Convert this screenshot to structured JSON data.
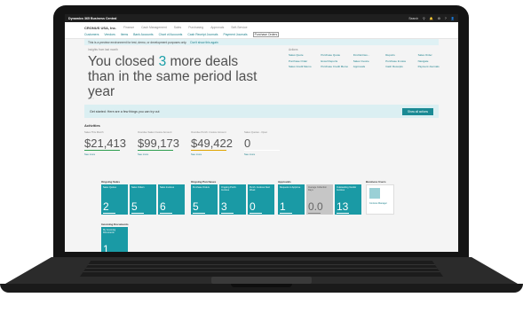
{
  "window": {
    "app_title": "Dynamics 365 Business Central",
    "search_label": "Search",
    "topbar_right": [
      "Search",
      "⚲",
      "🔔",
      "⚙",
      "?",
      "👤"
    ]
  },
  "nav": {
    "company": "CRONUS USA, Inc.",
    "menus": [
      "Finance",
      "Cash Management",
      "Sales",
      "Purchasing",
      "Approvals",
      "Self-Service"
    ],
    "links": [
      "Customers",
      "Vendors",
      "Items",
      "Bank Accounts",
      "Chart of Accounts",
      "Cash Receipt Journals",
      "Payment Journals",
      "Purchase Orders"
    ]
  },
  "notice": {
    "text": "This is a preview environment for test, demo, or development purposes only.",
    "link": "Don't show this again"
  },
  "hero": {
    "caption": "Insights from last month",
    "text_before": "You closed ",
    "highlight": "3",
    "text_after": " more deals than in the same period last year",
    "pager": "● ○ ○"
  },
  "actions": {
    "title": "Actions",
    "items": [
      "Sales Quote",
      "Purchase Quote",
      "Find Entries...",
      "Reports",
      "Sales Order",
      "Purchase Order",
      "Excel Reports",
      "Sales Invoice",
      "Purchase Invoice",
      "Navigate",
      "Sales Credit Memo",
      "Purchase Credit Memo",
      "Approvals",
      "Cash Receipts",
      "Payment Journals"
    ]
  },
  "banner": {
    "text": "Get started: Here are a few things you can try out",
    "button": "Show all actions"
  },
  "activities": {
    "title": "Activities",
    "kpis": [
      {
        "label": "Sales This Month",
        "value": "$21,413",
        "link": "See more",
        "bar_color": "#2e9e4f"
      },
      {
        "label": "Overdue Sales Invoice Amount",
        "value": "$99,173",
        "link": "See more",
        "bar_color": "#2e9e4f"
      },
      {
        "label": "Overdue Purch. Invoice Amount",
        "value": "$49,422",
        "link": "See more",
        "bar_color": "#e0a400"
      },
      {
        "label": "Sales Quotes - Open",
        "value": "0",
        "link": "See more",
        "bar_color": "#ffffff"
      }
    ]
  },
  "tile_groups": {
    "ongoing_sales": {
      "title": "Ongoing Sales",
      "tiles": [
        {
          "label": "Sales Quotes",
          "value": "2"
        },
        {
          "label": "Sales Orders",
          "value": "5"
        },
        {
          "label": "Sales Invoices",
          "value": "6"
        }
      ]
    },
    "ongoing_purchases": {
      "title": "Ongoing Purchases",
      "tiles": [
        {
          "label": "Purchase Orders",
          "value": "5"
        },
        {
          "label": "Ongoing Purch. Invoices",
          "value": "3"
        },
        {
          "label": "Purch. Invoices Next Week",
          "value": "0"
        }
      ]
    },
    "approvals": {
      "title": "Approvals",
      "tiles": [
        {
          "label": "Requests to Approve",
          "value": "1",
          "grey": false
        },
        {
          "label": "Average Collection Days",
          "value": "0.0",
          "grey": true
        },
        {
          "label": "Outstanding Vendor Invoices",
          "value": "13",
          "grey": false
        }
      ]
    },
    "user": {
      "title": "Business Users",
      "name": "Contoso Manager"
    },
    "incoming": {
      "title": "Incoming Documents",
      "tiles": [
        {
          "label": "My Incoming Documents",
          "value": "1"
        }
      ]
    }
  }
}
